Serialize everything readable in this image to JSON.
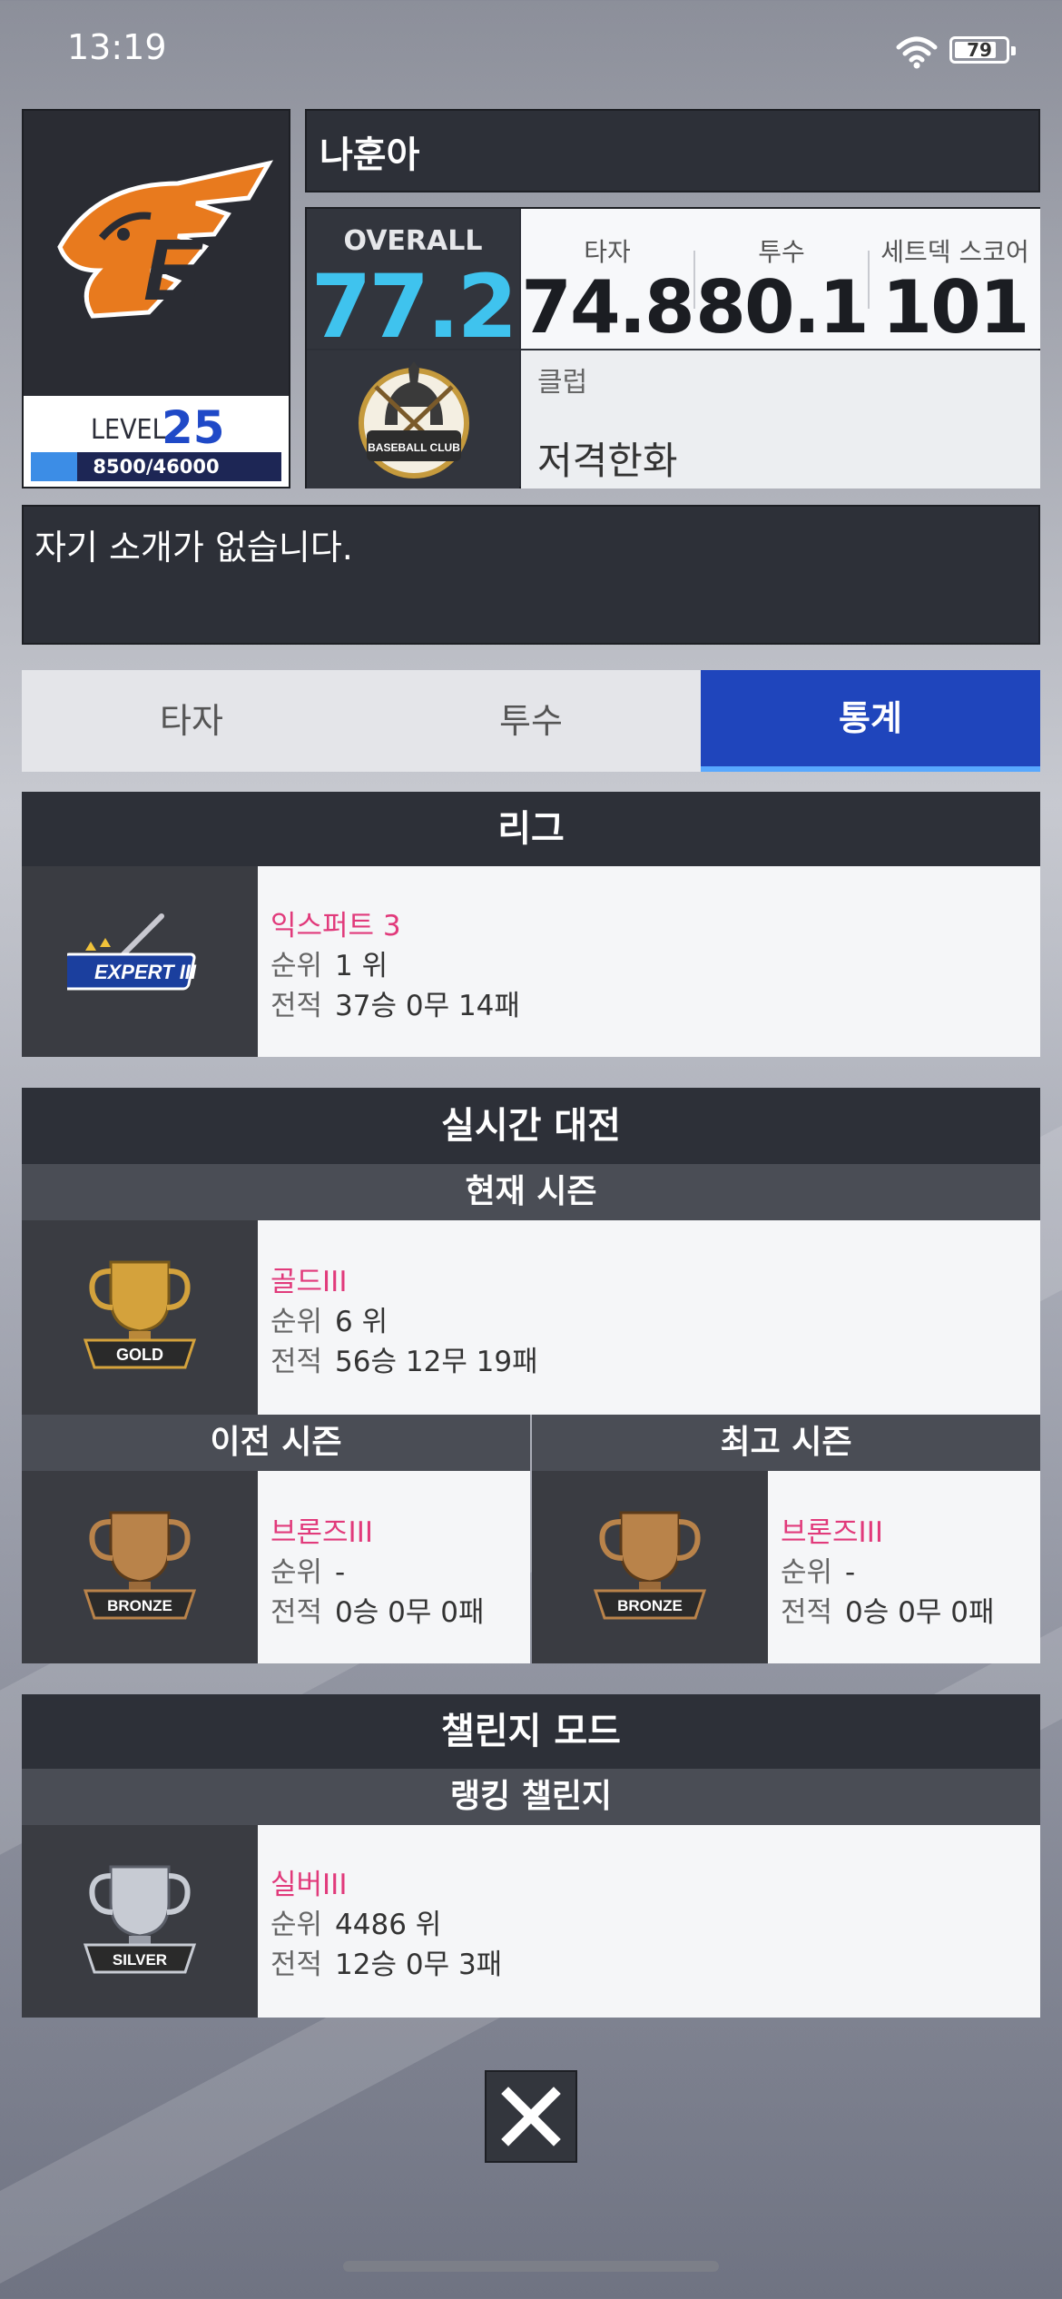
{
  "status_bar": {
    "time": "13:19",
    "battery": "79"
  },
  "profile": {
    "name": "나훈아",
    "level_label": "LEVEL",
    "level": "25",
    "xp_text": "8500/46000",
    "xp_fraction": 0.185,
    "overall_label": "OVERALL",
    "overall": "77.2",
    "scores": [
      {
        "label": "타자",
        "value": "74.8"
      },
      {
        "label": "투수",
        "value": "80.1"
      },
      {
        "label": "세트덱 스코어",
        "value": "101"
      }
    ],
    "club_label": "클럽",
    "club_name": "저격한화",
    "club_logo_text": "BASEBALL CLUB",
    "team_logo_letter": "E",
    "intro": "자기 소개가 없습니다."
  },
  "tabs": [
    {
      "label": "타자",
      "active": false
    },
    {
      "label": "투수",
      "active": false
    },
    {
      "label": "통계",
      "active": true
    }
  ],
  "league": {
    "title": "리그",
    "badge_text": "EXPERT III",
    "tier": "익스퍼트 3",
    "rank_label": "순위",
    "rank_value": "1 위",
    "record_label": "전적",
    "record_value": "37승 0무 14패"
  },
  "realtime": {
    "title": "실시간 대전",
    "current_title": "현재 시즌",
    "current": {
      "badge_text": "GOLD",
      "tier": "골드III",
      "rank_label": "순위",
      "rank_value": "6 위",
      "record_label": "전적",
      "record_value": "56승 12무 19패"
    },
    "previous_title": "이전 시즌",
    "previous": {
      "badge_text": "BRONZE",
      "tier": "브론즈III",
      "rank_label": "순위",
      "rank_value": "-",
      "record_label": "전적",
      "record_value": "0승 0무 0패"
    },
    "best_title": "최고 시즌",
    "best": {
      "badge_text": "BRONZE",
      "tier": "브론즈III",
      "rank_label": "순위",
      "rank_value": "-",
      "record_label": "전적",
      "record_value": "0승 0무 0패"
    }
  },
  "challenge": {
    "title": "챌린지 모드",
    "sub_title": "랭킹 챌린지",
    "badge_text": "SILVER",
    "tier": "실버III",
    "rank_label": "순위",
    "rank_value": "4486 위",
    "record_label": "전적",
    "record_value": "12승 0무 3패"
  },
  "colors": {
    "accent_blue": "#1f45bc",
    "overall_cyan": "#3fc3ee",
    "tier_pink": "#e13a7b",
    "gold": "#d4a23c",
    "bronze": "#b9834a",
    "silver": "#c7cbd3"
  }
}
